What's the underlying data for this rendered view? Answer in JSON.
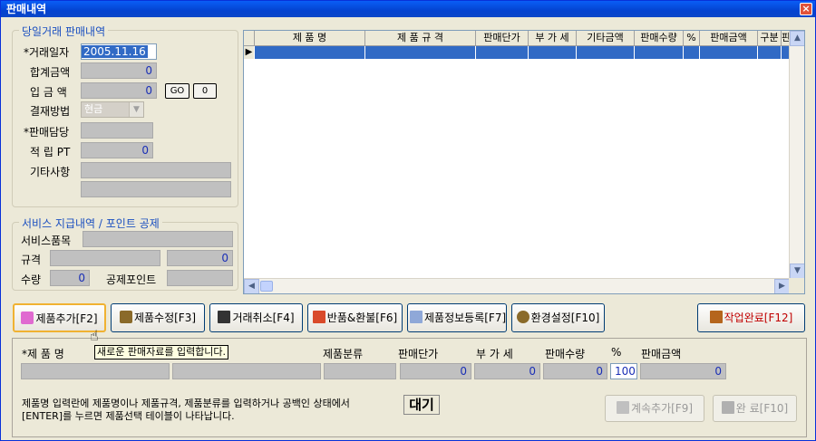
{
  "window": {
    "title": "판매내역",
    "close_label": "×"
  },
  "sales_group": {
    "title": "당일거래 판매내역",
    "labels": {
      "trade_date": "*거래일자",
      "total_amount": "합계금액",
      "deposit": "입 금 액",
      "payment_method": "결재방법",
      "sales_staff": "*판매담당",
      "points": "적 립 PT",
      "notes": "기타사항"
    },
    "values": {
      "trade_date": "2005.11.16",
      "total_amount": "0",
      "deposit": "0",
      "payment_method": "현금",
      "points": "0"
    },
    "go_button": "GO",
    "zero_button": "0"
  },
  "service_group": {
    "title": "서비스 지급내역 / 포인트 공제",
    "labels": {
      "service_item": "서비스품목",
      "spec": "규격",
      "qty": "수량",
      "deduct_points": "공제포인트"
    },
    "values": {
      "spec_value": "0",
      "qty": "0"
    }
  },
  "grid": {
    "columns": [
      "제 품 명",
      "제 품 규 격",
      "판매단가",
      "부 가 세",
      "기타금액",
      "판매수량",
      "%",
      "판매금액",
      "구분",
      "판"
    ]
  },
  "toolbar": {
    "add": "제품추가[F2]",
    "edit": "제품수정[F3]",
    "cancel": "거래취소[F4]",
    "return": "반품&환불[F6]",
    "register": "제품정보등록[F7]",
    "settings": "환경설정[F10]",
    "finish": "작업완료[F12]"
  },
  "entry": {
    "labels": {
      "product_name": "*제 품 명",
      "category": "제품분류",
      "price": "판매단가",
      "vat": "부 가 세",
      "qty": "판매수량",
      "percent": "%",
      "amount": "판매금액"
    },
    "tooltip": "새로운 판매자료를 입력합니다.",
    "values": {
      "price": "0",
      "vat": "0",
      "qty": "0",
      "percent": "100",
      "amount": "0"
    },
    "hint_line1": "제품명 입력란에 제품명이나 제품규격, 제품분류를 입력하거나 공백인 상태에서",
    "hint_line2": "[ENTER]를 누르면 제품선택 테이블이 나타납니다.",
    "status": "대기",
    "continue_button": "계속추가[F9]",
    "done_button": "완 료[F10]"
  },
  "colors": {
    "title_bar": "#0a5ef6",
    "group_title": "#1a4fc0",
    "selection": "#316ac5",
    "value_text": "#1a2fb5"
  }
}
